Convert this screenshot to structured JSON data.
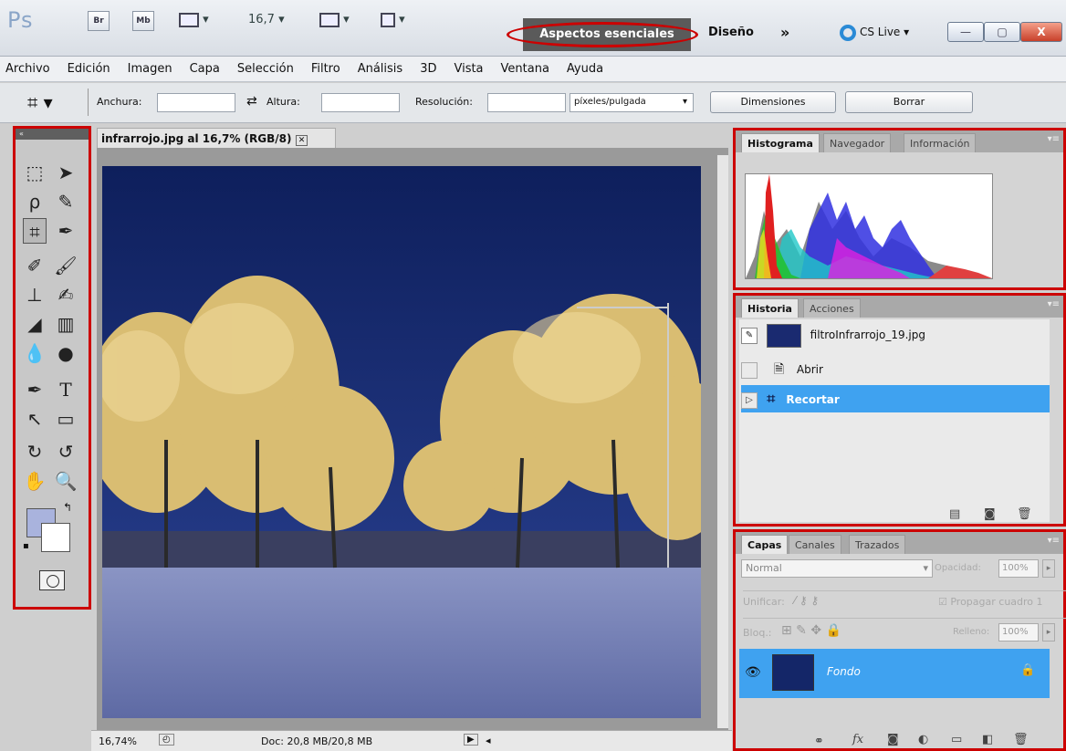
{
  "appbar": {
    "logo": "Ps",
    "bridge_label": "Br",
    "minibridge_label": "Mb",
    "zoom_value": "16,7",
    "workspace_active": "Aspectos esenciales",
    "workspace_other": "Diseño",
    "more_label": "»",
    "cslive_label": "CS Live",
    "minimize": "—",
    "maximize": "▢",
    "close": "X"
  },
  "menu": [
    "Archivo",
    "Edición",
    "Imagen",
    "Capa",
    "Selección",
    "Filtro",
    "Análisis",
    "3D",
    "Vista",
    "Ventana",
    "Ayuda"
  ],
  "options": {
    "width_label": "Anchura:",
    "height_label": "Altura:",
    "resolution_label": "Resolución:",
    "units_value": "píxeles/pulgada",
    "dimensions_button": "Dimensiones",
    "clear_button": "Borrar",
    "width_value": "",
    "height_value": "",
    "resolution_value": ""
  },
  "toolbox": {
    "collapse_label": "«"
  },
  "document": {
    "tab_title": "infrarrojo.jpg al 16,7% (RGB/8)",
    "zoom_status": "16,74%",
    "doc_info": "Doc: 20,8 MB/20,8 MB"
  },
  "histogram_panel": {
    "tabs": [
      "Histograma",
      "Navegador",
      "Información"
    ]
  },
  "history_panel": {
    "tabs": [
      "Historia",
      "Acciones"
    ],
    "snapshot": "filtroInfrarrojo_19.jpg",
    "steps": [
      "Abrir",
      "Recortar"
    ],
    "selected_step": "Recortar"
  },
  "layers_panel": {
    "tabs": [
      "Capas",
      "Canales",
      "Trazados"
    ],
    "blend_mode": "Normal",
    "opacity_label": "Opacidad:",
    "opacity_value": "100%",
    "unify_label": "Unificar:",
    "propagate_label": "Propagar cuadro 1",
    "lock_label": "Bloq.:",
    "fill_label": "Relleno:",
    "fill_value": "100%",
    "layer_name": "Fondo"
  },
  "colors": {
    "accent": "#3fa2f0",
    "annotation": "#cc0000",
    "foreground": "#a9b3dd",
    "background": "#ffffff"
  }
}
